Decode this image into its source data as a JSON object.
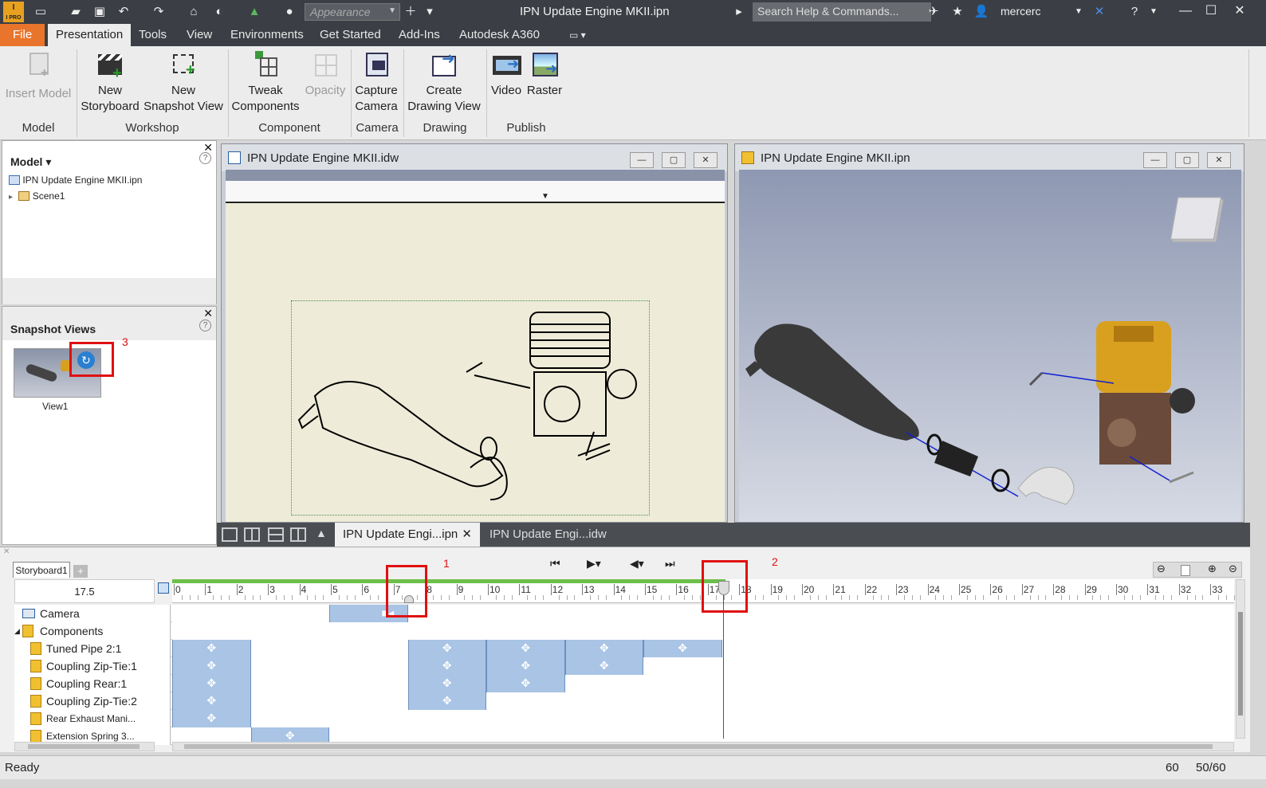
{
  "title_bar": {
    "app_logo": "I PRO",
    "appearance_placeholder": "Appearance",
    "window_title": "IPN Update Engine MKII.ipn",
    "search_placeholder": "Search Help & Commands...",
    "user_name": "mercerc"
  },
  "menu": {
    "tabs": [
      "File",
      "Presentation",
      "Tools",
      "View",
      "Environments",
      "Get Started",
      "Add-Ins",
      "Autodesk A360"
    ],
    "active_tab": "Presentation"
  },
  "ribbon": {
    "buttons": [
      {
        "label": "Insert Model",
        "disabled": true
      },
      {
        "label": "New Storyboard",
        "line1": "New",
        "line2": "Storyboard"
      },
      {
        "label": "New Snapshot View",
        "line1": "New",
        "line2": "Snapshot View"
      },
      {
        "label": "Tweak Components",
        "line1": "Tweak",
        "line2": "Components"
      },
      {
        "label": "Opacity",
        "disabled": true
      },
      {
        "label": "Capture Camera",
        "line1": "Capture",
        "line2": "Camera"
      },
      {
        "label": "Create Drawing View",
        "line1": "Create",
        "line2": "Drawing View"
      },
      {
        "label": "Video"
      },
      {
        "label": "Raster"
      }
    ],
    "groups": [
      "Model",
      "Workshop",
      "Component",
      "Camera",
      "Drawing",
      "Publish"
    ]
  },
  "model_panel": {
    "header": "Model",
    "tree": [
      "IPN Update Engine MKII.ipn",
      "Scene1"
    ]
  },
  "snapshot_panel": {
    "header": "Snapshot Views",
    "items": [
      {
        "label": "View1"
      }
    ],
    "annotation": "3"
  },
  "doc_windows": {
    "drawing_title": "IPN Update Engine MKII.idw",
    "model_title": "IPN Update Engine MKII.ipn"
  },
  "doc_tabs": {
    "tabs": [
      "IPN Update Engi...ipn",
      "IPN Update Engi...idw"
    ],
    "active": 0
  },
  "timeline": {
    "storyboard_tab": "Storyboard1",
    "current_time": "17.5",
    "ticks": [
      "0",
      "1",
      "2",
      "3",
      "4",
      "5",
      "6",
      "7",
      "8",
      "9",
      "10",
      "11",
      "12",
      "13",
      "14",
      "15",
      "16",
      "17",
      "18",
      "19",
      "20",
      "21",
      "22",
      "23",
      "24",
      "25",
      "26",
      "27",
      "28",
      "29",
      "30",
      "31",
      "32",
      "33"
    ],
    "annotation_1": "1",
    "annotation_2": "2",
    "rows": [
      {
        "label": "Camera",
        "blocks": [
          [
            5,
            7.5
          ]
        ]
      },
      {
        "label": "Components",
        "blocks": []
      },
      {
        "label": "Tuned Pipe 2:1",
        "blocks": [
          [
            0,
            2.5
          ],
          [
            7.5,
            10
          ],
          [
            10,
            12.5
          ],
          [
            12.5,
            15
          ],
          [
            15,
            17.5
          ]
        ]
      },
      {
        "label": "Coupling Zip-Tie:1",
        "blocks": [
          [
            0,
            2.5
          ],
          [
            7.5,
            10
          ],
          [
            10,
            12.5
          ],
          [
            12.5,
            15
          ]
        ]
      },
      {
        "label": "Coupling Rear:1",
        "blocks": [
          [
            0,
            2.5
          ],
          [
            7.5,
            10
          ],
          [
            10,
            12.5
          ]
        ]
      },
      {
        "label": "Coupling Zip-Tie:2",
        "blocks": [
          [
            0,
            2.5
          ],
          [
            7.5,
            10
          ]
        ]
      },
      {
        "label": "Rear Exhaust Mani...",
        "blocks": [
          [
            0,
            2.5
          ]
        ]
      },
      {
        "label": "Extension Spring 3...",
        "blocks": [
          [
            2.5,
            5
          ]
        ]
      }
    ]
  },
  "status_bar": {
    "text": "Ready",
    "count1": "60",
    "count2": "50/60"
  },
  "colors": {
    "accent_file": "#e8752b",
    "anim_block": "#a9c4e4",
    "annotation_red": "#e01010",
    "timeline_green": "#6cc04a"
  }
}
